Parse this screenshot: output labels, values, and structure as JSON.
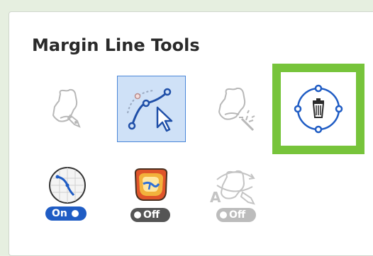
{
  "panel": {
    "title": "Margin Line Tools"
  },
  "tools": [
    {
      "name": "margin-line-draw-tool",
      "state": "disabled"
    },
    {
      "name": "margin-line-edit-tool",
      "state": "selected"
    },
    {
      "name": "margin-line-auto-tool",
      "state": "disabled"
    },
    {
      "name": "margin-line-delete-tool",
      "state": "highlighted",
      "icon": "trash-icon"
    }
  ],
  "toggles": {
    "tool1": {
      "label": "On"
    },
    "tool2": {
      "label": "Off"
    },
    "tool3": {
      "label": "Off"
    }
  },
  "colors": {
    "accent": "#1f5cc4",
    "highlight": "#77c43b",
    "selected_bg": "#cfe1f7"
  }
}
